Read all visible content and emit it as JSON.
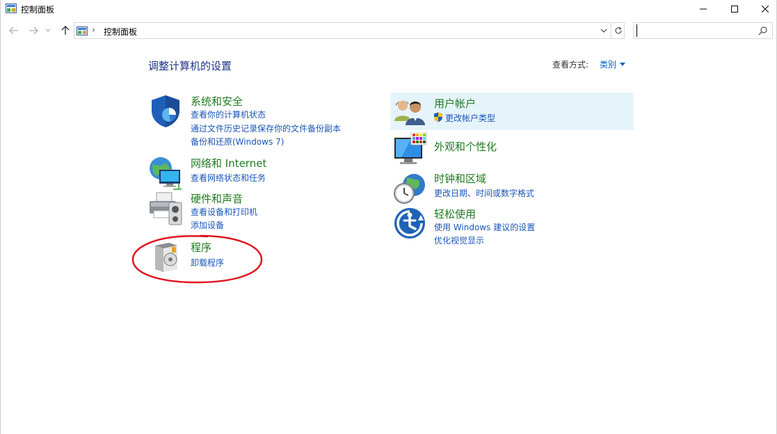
{
  "window": {
    "title": "控制面板",
    "minimize_icon": "minimize-icon",
    "maximize_icon": "maximize-icon",
    "close_icon": "close-icon"
  },
  "address_bar": {
    "breadcrumb": "控制面板",
    "separator": "›",
    "search_placeholder": "",
    "search_value": ""
  },
  "main": {
    "title": "调整计算机的设置",
    "view_by_label": "查看方式:",
    "view_by_value": "类别"
  },
  "categories_left": [
    {
      "title": "系统和安全",
      "icon": "shield-icon",
      "links": [
        "查看你的计算机状态",
        "通过文件历史记录保存你的文件备份副本",
        "备份和还原(Windows 7)"
      ]
    },
    {
      "title": "网络和 Internet",
      "icon": "network-icon",
      "links": [
        "查看网络状态和任务"
      ]
    },
    {
      "title": "硬件和声音",
      "icon": "printer-icon",
      "links": [
        "查看设备和打印机",
        "添加设备"
      ]
    },
    {
      "title": "程序",
      "icon": "programs-icon",
      "links": [
        "卸载程序"
      ]
    }
  ],
  "categories_right": [
    {
      "title": "用户帐户",
      "icon": "users-icon",
      "links": [
        "更改帐户类型"
      ],
      "link_icon": "uac-shield-icon"
    },
    {
      "title": "外观和个性化",
      "icon": "monitor-icon",
      "links": []
    },
    {
      "title": "时钟和区域",
      "icon": "clock-icon",
      "links": [
        "更改日期、时间或数字格式"
      ]
    },
    {
      "title": "轻松使用",
      "icon": "ease-of-access-icon",
      "links": [
        "使用 Windows 建议的设置",
        "优化视觉显示"
      ]
    }
  ],
  "colors": {
    "title_blue": "#1e3287",
    "category_green": "#1e7b1e",
    "link_blue": "#1a56b8",
    "hover_bg": "#e5f3fb",
    "annotation_red": "#e0141e"
  }
}
